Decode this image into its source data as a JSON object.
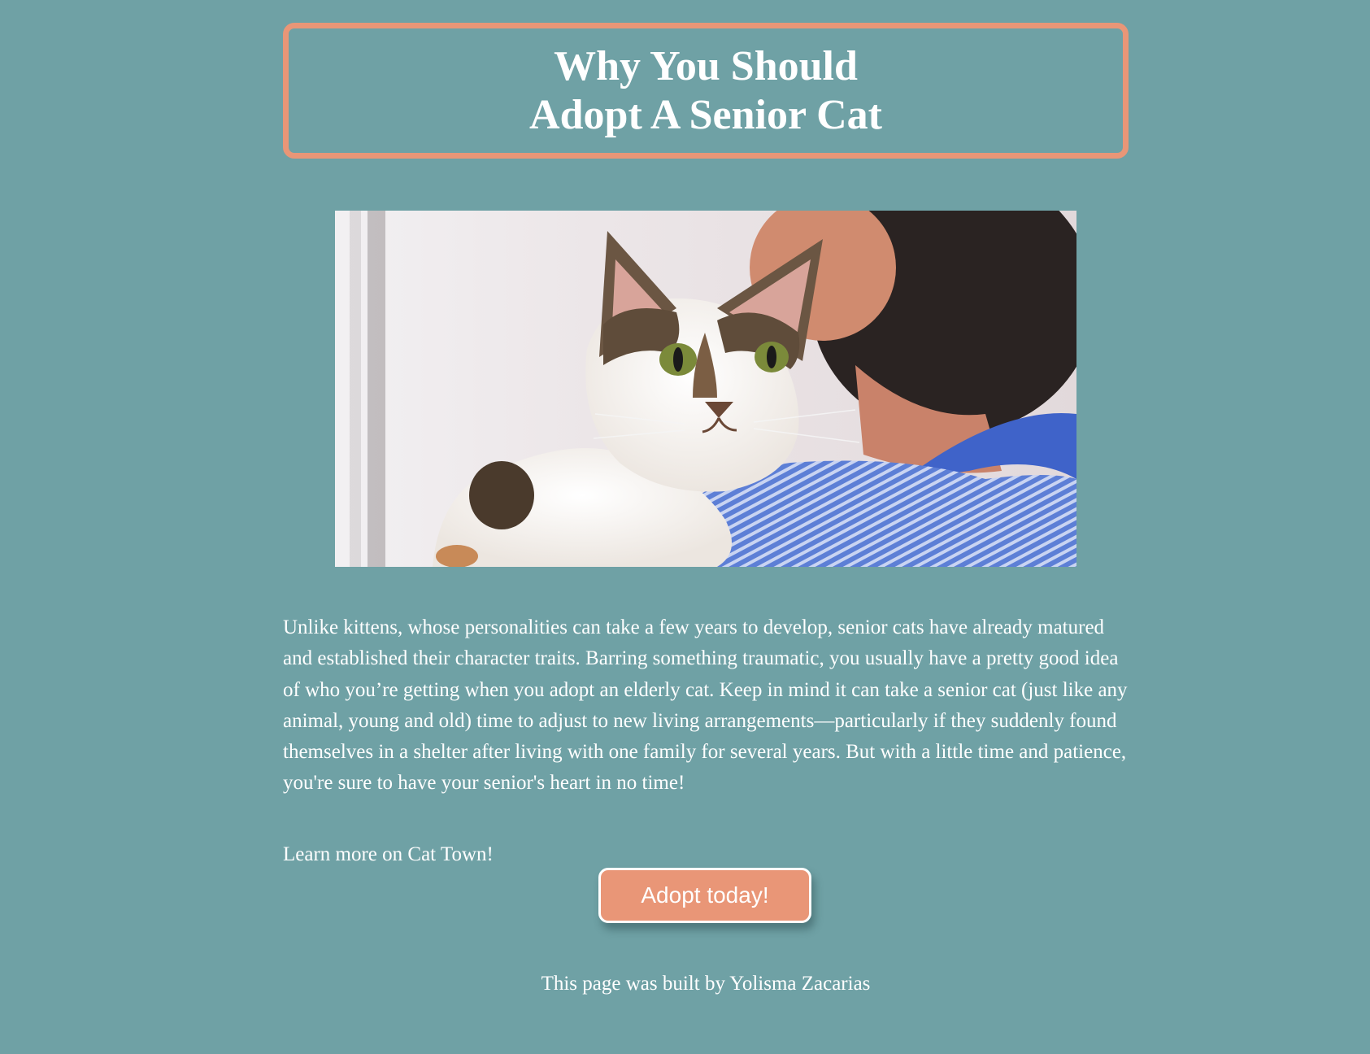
{
  "header": {
    "title_line1": "Why You Should",
    "title_line2": "Adopt A Senior Cat"
  },
  "hero_image": {
    "subject": "senior-cat-held-on-shoulder-photo"
  },
  "main": {
    "paragraph": "Unlike kittens, whose personalities can take a few years to develop, senior cats have already matured and established their character traits. Barring something traumatic, you usually have a pretty good idea of who you’re getting when you adopt an elderly cat. Keep in mind it can take a senior cat (just like any animal, young and old) time to adjust to new living arrangements—particularly if they suddenly found themselves in a shelter after living with one family for several years. But with a little time and patience, you're sure to have your senior's heart in no time!",
    "learn_more_link": "Learn more on Cat Town!",
    "adopt_button": "Adopt today!"
  },
  "footer": {
    "credit": "This page was built by Yolisma Zacarias"
  },
  "colors": {
    "background": "#6fa1a5",
    "accent": "#e99677",
    "text": "#ffffff"
  }
}
